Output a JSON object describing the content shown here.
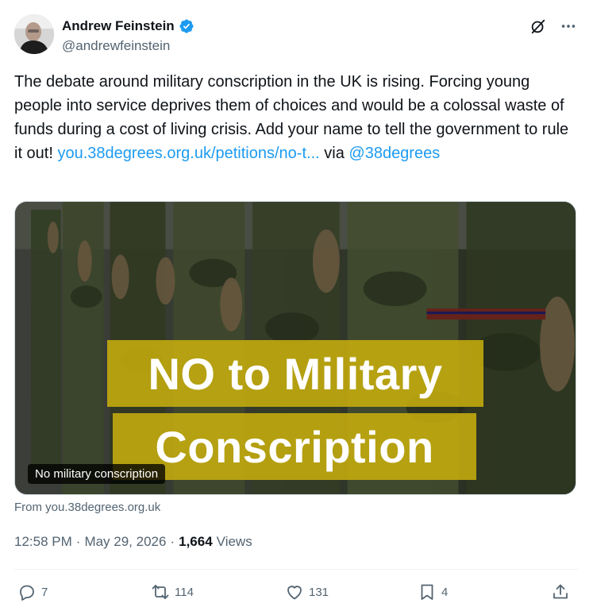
{
  "author": {
    "name": "Andrew Feinstein",
    "handle": "@andrewfeinstein",
    "verified_color": "#1d9bf0"
  },
  "tweet": {
    "text_part1": "The debate around military conscription in the UK is rising. Forcing young people into service deprives them of choices and would be a colossal waste of funds during a cost of living crisis. Add your name to tell the government to rule it out! ",
    "link": "you.38degrees.org.uk/petitions/no-t...",
    "text_part2": " via ",
    "mention": "@38degrees"
  },
  "media": {
    "banner_line1": "NO to Military",
    "banner_line2": "Conscription",
    "alt_text": "No military conscription",
    "banner_color": "#c9b00d"
  },
  "source": "From you.38degrees.org.uk",
  "meta": {
    "time": "12:58 PM",
    "separator": "·",
    "date": "May 29, 2026",
    "separator2": "·",
    "views_count": "1,664",
    "views_label": "Views"
  },
  "actions": {
    "replies": "7",
    "reposts": "114",
    "likes": "131",
    "bookmarks": "4"
  },
  "icons": [
    "grok-icon",
    "more-icon",
    "reply-icon",
    "repost-icon",
    "like-icon",
    "bookmark-icon",
    "share-icon",
    "verified-icon"
  ]
}
